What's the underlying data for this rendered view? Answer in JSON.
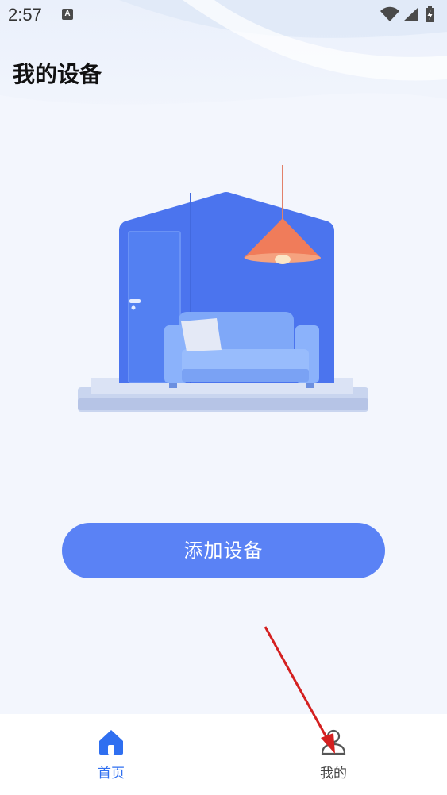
{
  "status_bar": {
    "time": "2:57",
    "notification_icon": "a-letter-icon",
    "icons": [
      "wifi-icon",
      "signal-icon",
      "battery-charging-icon"
    ]
  },
  "page": {
    "title": "我的设备"
  },
  "illustration": {
    "icon": "living-room-house-illustration"
  },
  "actions": {
    "add_device_label": "添加设备"
  },
  "bottom_nav": {
    "items": [
      {
        "label": "首页",
        "icon": "home-icon",
        "active": true
      },
      {
        "label": "我的",
        "icon": "user-icon",
        "active": false
      }
    ]
  },
  "colors": {
    "accent": "#5a82f5",
    "nav_active": "#2f6ff0",
    "background": "#f3f6fd",
    "annotation": "#d42020"
  }
}
